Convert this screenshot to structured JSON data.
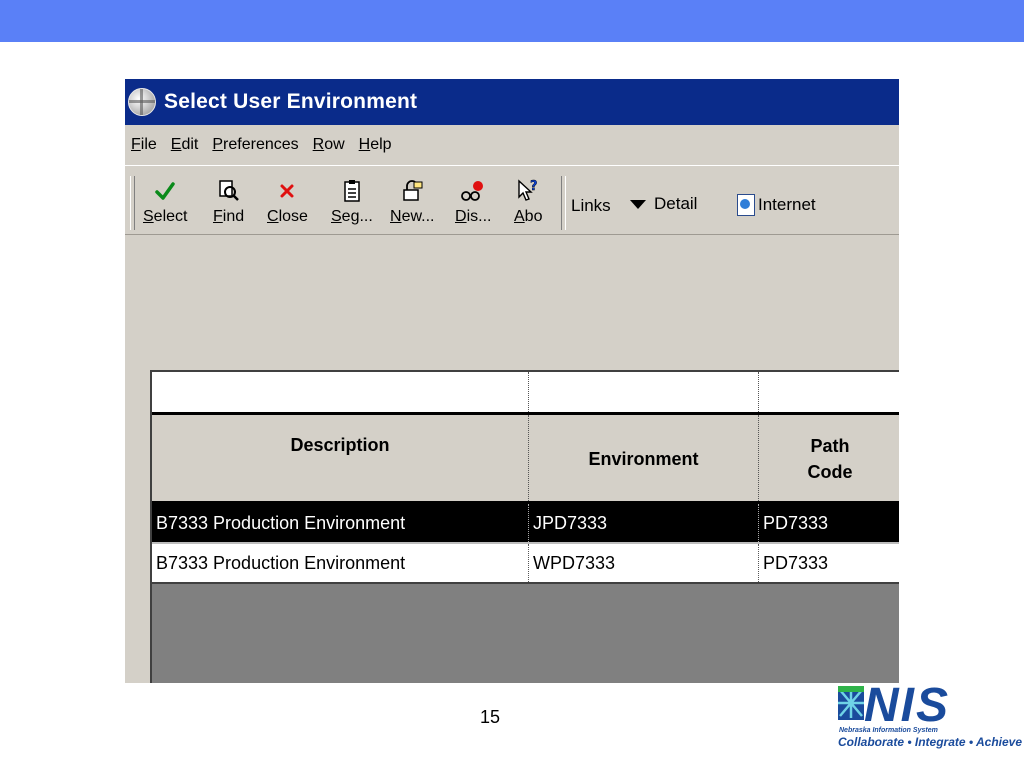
{
  "window": {
    "title": "Select User Environment"
  },
  "menu": [
    "File",
    "Edit",
    "Preferences",
    "Row",
    "Help"
  ],
  "toolbar": {
    "buttons": [
      {
        "label": "Select",
        "icon": "checkmark-icon"
      },
      {
        "label": "Find",
        "icon": "find-icon"
      },
      {
        "label": "Close",
        "icon": "close-icon"
      },
      {
        "label": "Seg...",
        "icon": "clipboard-icon"
      },
      {
        "label": "New...",
        "icon": "lock-icon"
      },
      {
        "label": "Dis...",
        "icon": "glasses-icon"
      },
      {
        "label": "Abo",
        "icon": "help-pointer-icon"
      }
    ],
    "links_label": "Links",
    "detail_label": "Detail",
    "internet_label": "Internet"
  },
  "grid": {
    "columns": [
      {
        "label": "Description"
      },
      {
        "label": "Environment"
      },
      {
        "label": "Path\nCode"
      }
    ],
    "rows": [
      {
        "description": "B7333 Production Environment",
        "environment": "JPD7333",
        "path_code": "PD7333",
        "selected": true
      },
      {
        "description": "B7333 Production Environment",
        "environment": "WPD7333",
        "path_code": "PD7333",
        "selected": false
      }
    ]
  },
  "slide": {
    "page_number": "15",
    "logo_text": "NIS",
    "logo_subtitle": "Nebraska Information System",
    "logo_tagline": "Collaborate • Integrate • Achieve"
  },
  "colors": {
    "header_band": "#5a80f7",
    "title_bar": "#0a2b8a",
    "window_bg": "#d4d0c8",
    "logo_blue": "#1a4b9c"
  }
}
